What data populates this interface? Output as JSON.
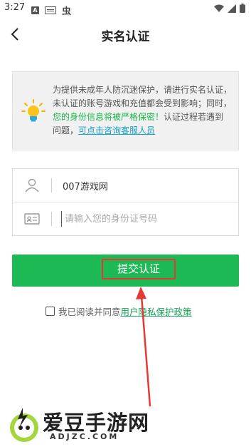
{
  "status_bar": {
    "time": "3:27",
    "icon_a": "A",
    "icon_glyph": "虫"
  },
  "header": {
    "title": "实名认证"
  },
  "notice": {
    "text_part1": "为提供未成年人防沉迷保护，请进行实名认证，未认证的账号游戏和充值都会受到影响；同时，",
    "text_green": "您的身份信息将被严格保密！",
    "text_part2": "认证过程若遇到问题，",
    "text_link": "可点击咨询客服人员"
  },
  "form": {
    "name_value": "007游戏网",
    "id_placeholder": "请输入您的身份证号码"
  },
  "submit": {
    "label": "提交认证"
  },
  "agreement": {
    "prefix": "我已阅读并同意",
    "link": "用户隐私保护政策"
  },
  "watermark": {
    "title": "爱豆手游网",
    "domain": "ADJZC.COM"
  },
  "colors": {
    "accent_green": "#1db954",
    "highlight_red": "#e53935",
    "link_blue": "#18a0c8"
  }
}
